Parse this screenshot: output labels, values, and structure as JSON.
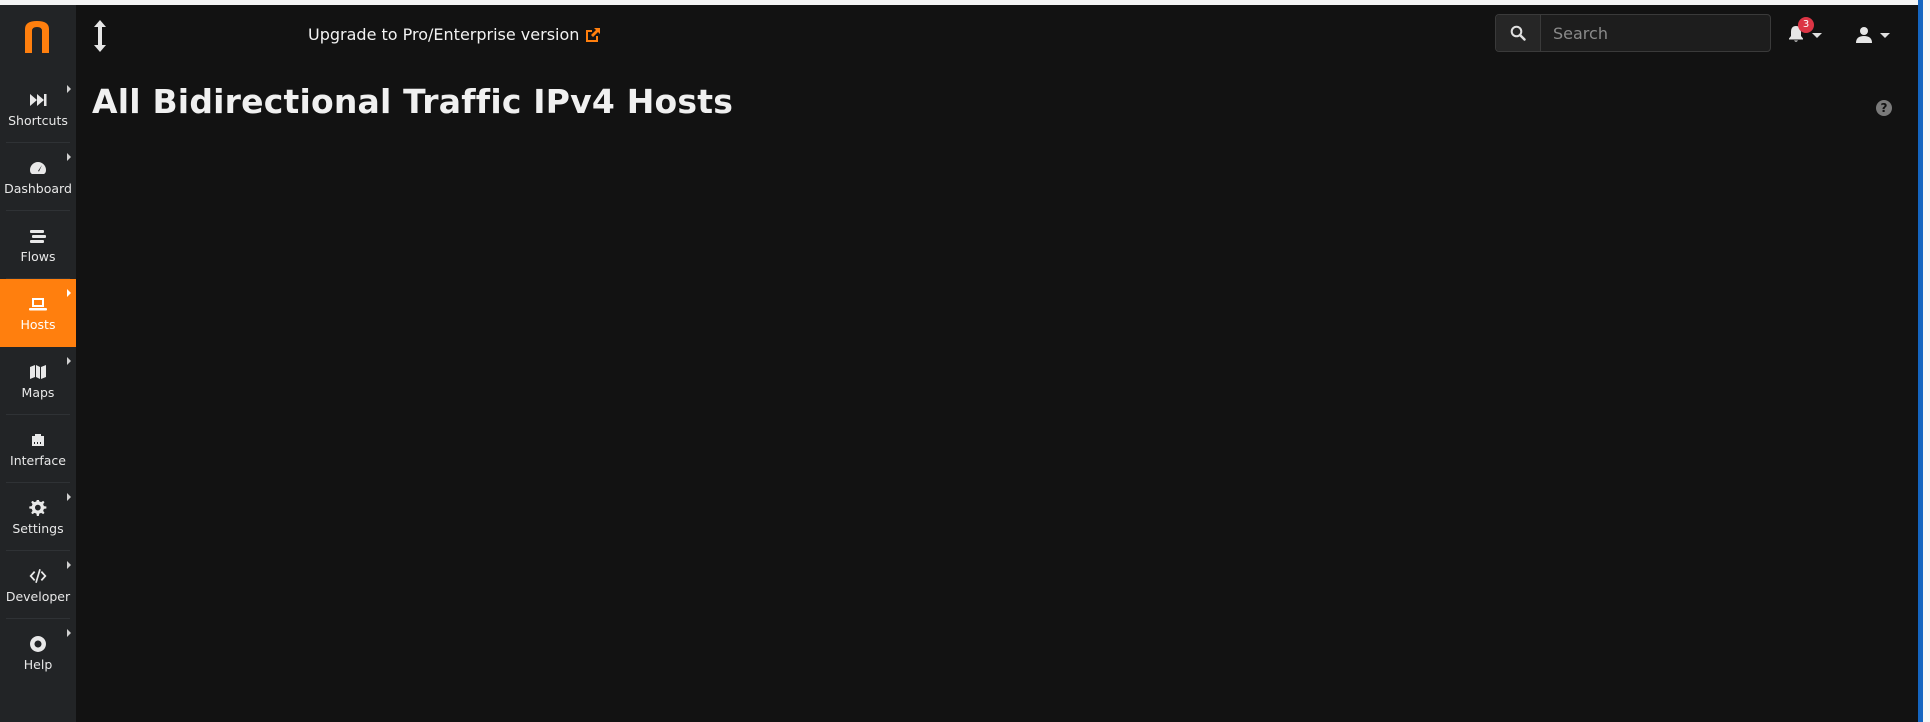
{
  "sidebar": {
    "logo": "n-logo",
    "items": [
      {
        "label": "Shortcuts",
        "icon": "fast-forward-icon",
        "has_submenu": true,
        "active": false
      },
      {
        "label": "Dashboard",
        "icon": "gauge-icon",
        "has_submenu": true,
        "active": false
      },
      {
        "label": "Flows",
        "icon": "stream-icon",
        "has_submenu": false,
        "active": false
      },
      {
        "label": "Hosts",
        "icon": "laptop-icon",
        "has_submenu": true,
        "active": true
      },
      {
        "label": "Maps",
        "icon": "map-icon",
        "has_submenu": true,
        "active": false
      },
      {
        "label": "Interface",
        "icon": "ethernet-icon",
        "has_submenu": false,
        "active": false
      },
      {
        "label": "Settings",
        "icon": "gear-icon",
        "has_submenu": true,
        "active": false
      },
      {
        "label": "Developer",
        "icon": "code-icon",
        "has_submenu": true,
        "active": false
      },
      {
        "label": "Help",
        "icon": "life-ring-icon",
        "has_submenu": true,
        "active": false
      }
    ]
  },
  "header": {
    "upgrade_label": "Upgrade to Pro/Enterprise version",
    "search_placeholder": "Search",
    "notification_count": "3"
  },
  "main": {
    "title": "All Bidirectional Traffic IPv4 Hosts"
  },
  "colors": {
    "accent": "#ff7f0e",
    "background": "#121212",
    "sidebar": "#222426",
    "badge": "#dc3545"
  }
}
